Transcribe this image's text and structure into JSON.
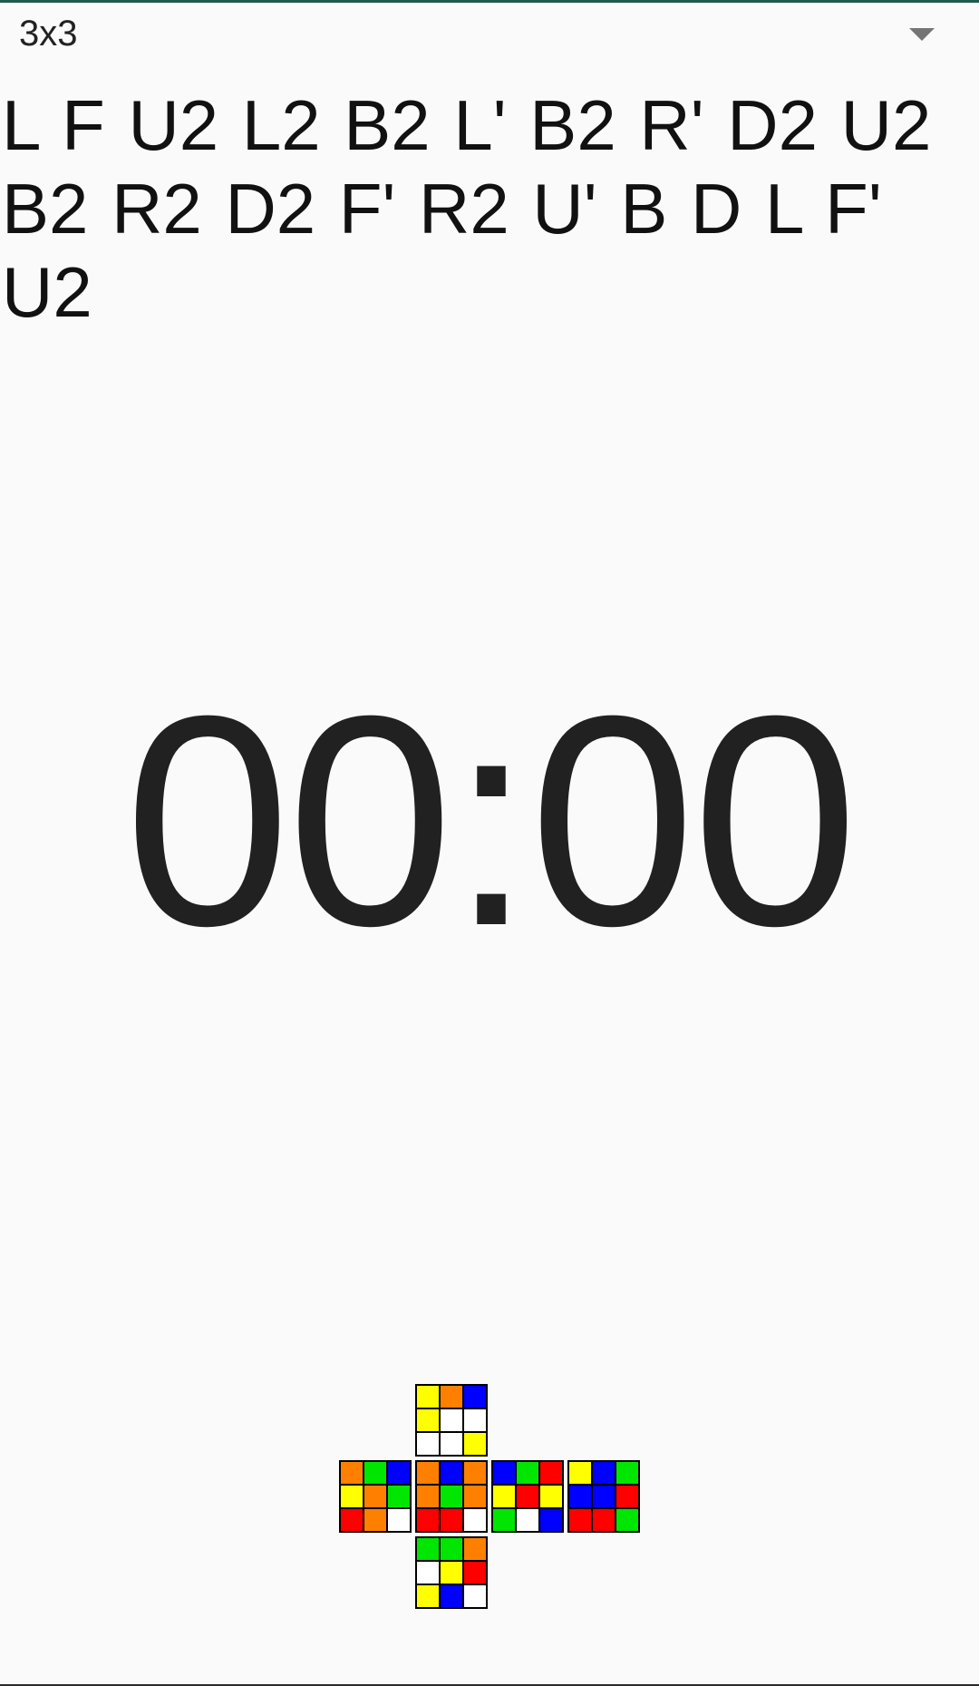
{
  "puzzle_selector": {
    "selected": "3x3"
  },
  "scramble": "L F U2 L2 B2 L' B2 R' D2 U2 B2 R2 D2 F' R2 U' B D L F' U2",
  "timer": {
    "display": "00:00"
  },
  "colors": {
    "W": "#ffffff",
    "Y": "#ffff00",
    "O": "#ff8000",
    "G": "#00e600",
    "B": "#0000ff",
    "R": "#ff0000",
    "accent_line": "#1f5a50"
  },
  "cube_net": {
    "U": [
      "Y",
      "O",
      "B",
      "Y",
      "W",
      "W",
      "W",
      "W",
      "Y"
    ],
    "L": [
      "O",
      "G",
      "B",
      "Y",
      "O",
      "G",
      "R",
      "O",
      "W"
    ],
    "F": [
      "O",
      "B",
      "O",
      "O",
      "G",
      "O",
      "R",
      "R",
      "W"
    ],
    "R": [
      "B",
      "G",
      "R",
      "Y",
      "R",
      "Y",
      "G",
      "W",
      "B"
    ],
    "B": [
      "Y",
      "B",
      "G",
      "B",
      "B",
      "R",
      "R",
      "R",
      "G"
    ],
    "D": [
      "G",
      "G",
      "O",
      "W",
      "Y",
      "R",
      "Y",
      "B",
      "W"
    ]
  }
}
